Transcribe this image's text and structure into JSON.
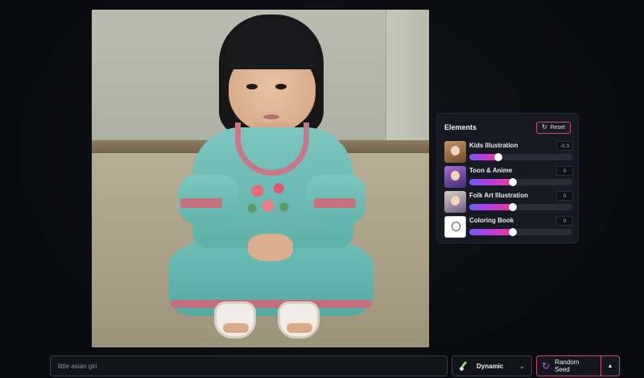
{
  "canvas": {
    "image_alt": "little asian girl"
  },
  "elements_panel": {
    "title": "Elements",
    "reset_label": "Reset",
    "reset_icon": "reset-icon",
    "items": [
      {
        "label": "Kids Illustration",
        "value": "-0.3",
        "fraction": 0.25,
        "thumb_icon": "kids-illustration-thumbnail"
      },
      {
        "label": "Toon & Anime",
        "value": "0",
        "fraction": 0.39,
        "thumb_icon": "toon-anime-thumbnail"
      },
      {
        "label": "Folk Art Illustration",
        "value": "0",
        "fraction": 0.39,
        "thumb_icon": "folk-art-thumbnail"
      },
      {
        "label": "Coloring Book",
        "value": "0",
        "fraction": 0.39,
        "thumb_icon": "coloring-book-thumbnail"
      }
    ]
  },
  "bottom_bar": {
    "prompt_value": "little asian girl",
    "style_label": "Dynamic",
    "style_icon": "brush-icon",
    "seed_label": "Random Seed",
    "seed_icon": "refresh-icon",
    "caret_icon": "caret-up-icon"
  },
  "colors": {
    "accent_pink": "#c2506b",
    "slider_start": "#6f5cf2",
    "slider_end": "#f0399a",
    "background": "#0b0c12"
  }
}
